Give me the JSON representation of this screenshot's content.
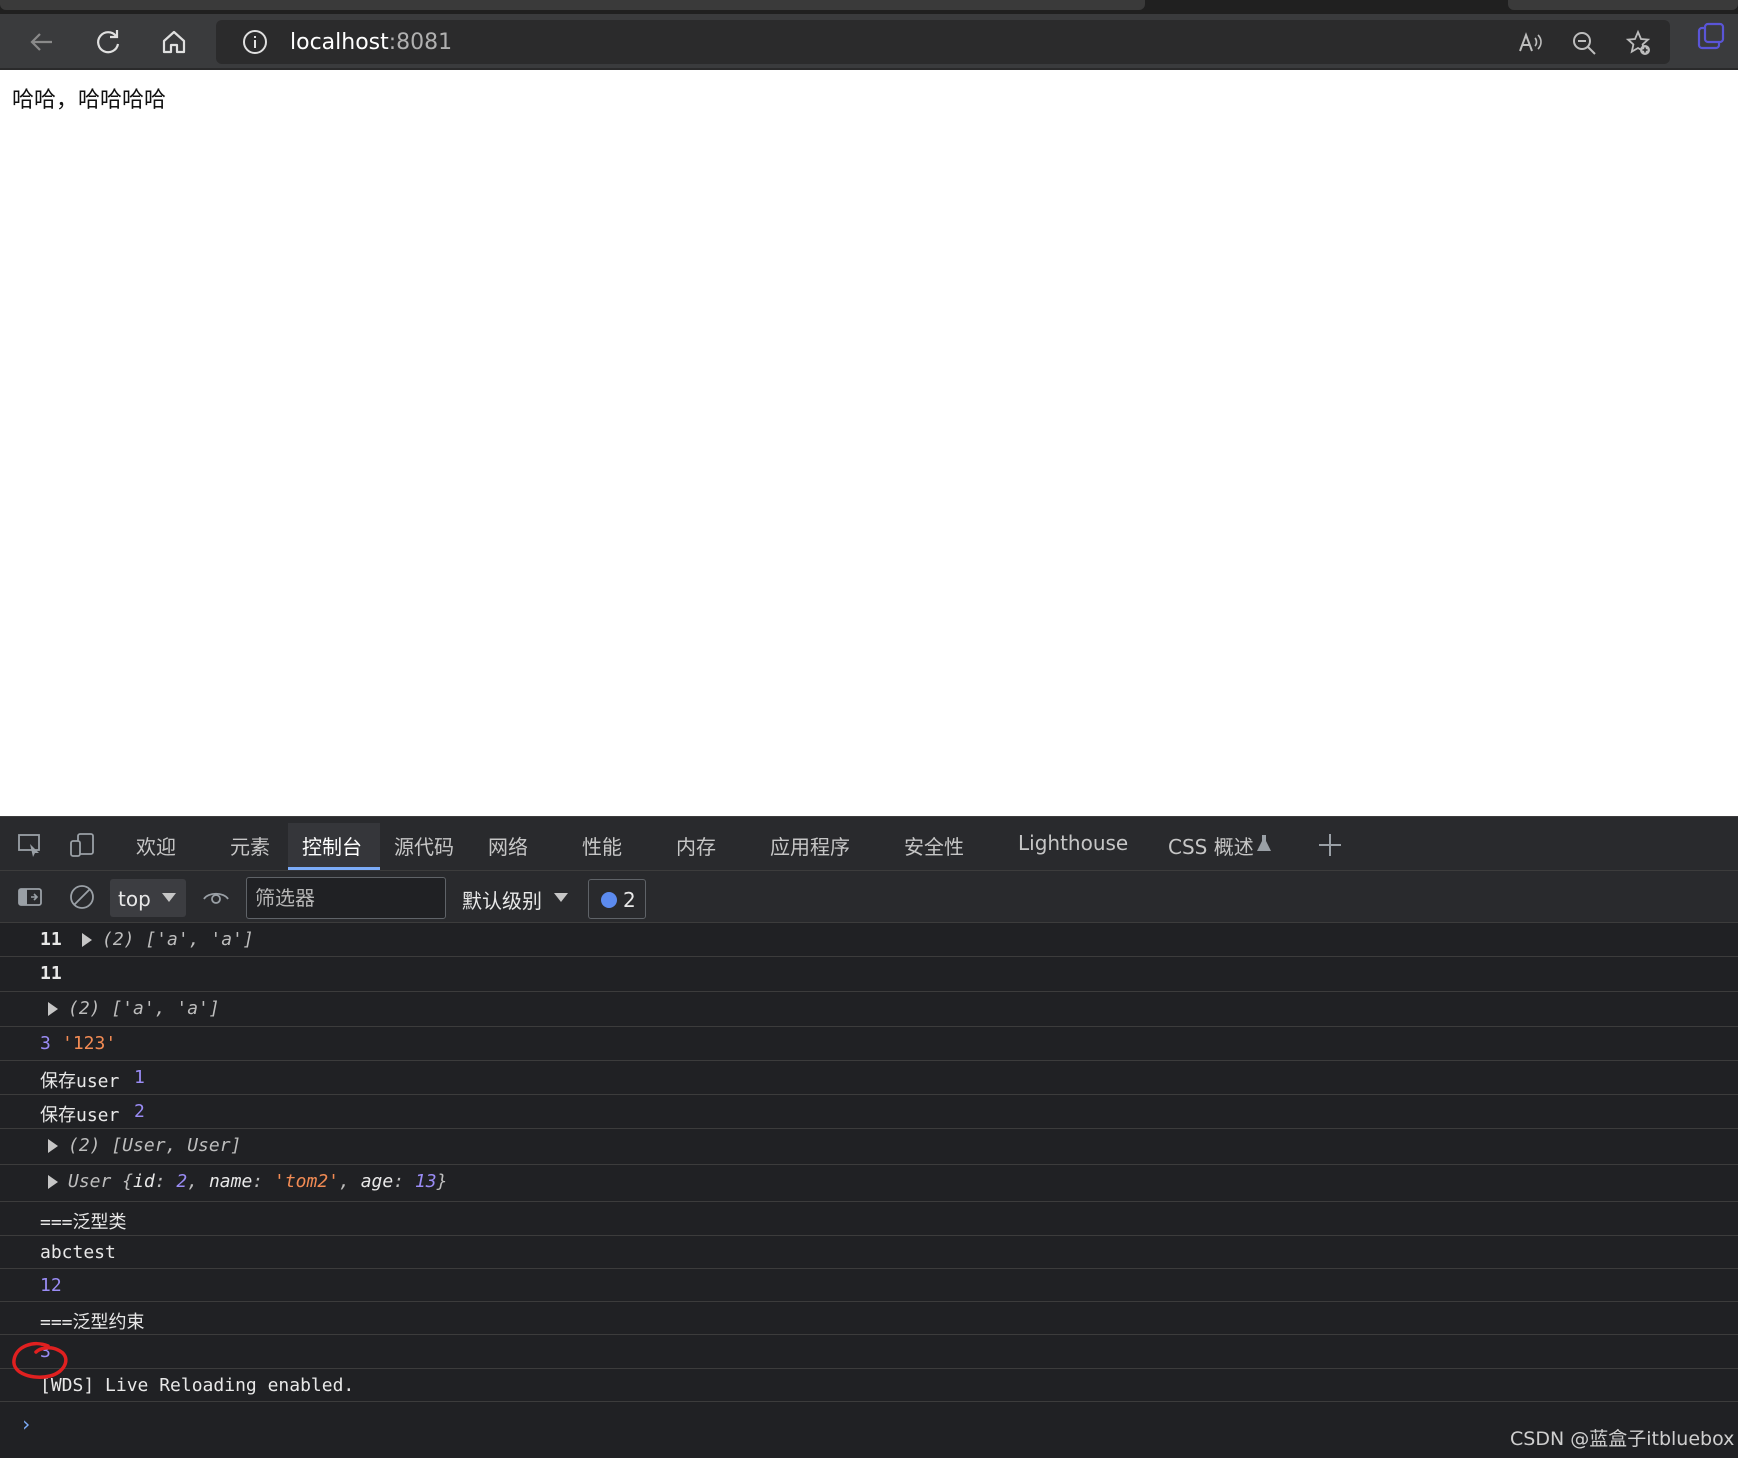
{
  "browser": {
    "url_host": "localhost",
    "url_port": ":8081",
    "icons": [
      "back-icon",
      "refresh-icon",
      "home-icon",
      "info-icon",
      "read-aloud-icon",
      "zoom-out-icon",
      "favorites-add-icon",
      "extension-icon"
    ]
  },
  "page": {
    "text": "哈哈，哈哈哈哈"
  },
  "devtools": {
    "tabs": [
      "欢迎",
      "元素",
      "控制台",
      "源代码",
      "网络",
      "性能",
      "内存",
      "应用程序",
      "安全性",
      "Lighthouse",
      "CSS 概述"
    ],
    "active_tab": "控制台",
    "toolbar": {
      "context": "top",
      "filter_placeholder": "筛选器",
      "level": "默认级别",
      "issues_count": "2"
    },
    "console": {
      "r1_num": "11",
      "r1_arr": "(2) ['a', 'a']",
      "r2_num": "11",
      "r3_arr": "(2) ['a', 'a']",
      "r4_num": "3",
      "r4_str": "'123'",
      "r5_txt": "保存user",
      "r5_num": "1",
      "r6_txt": "保存user",
      "r6_num": "2",
      "r7_arr": "(2) [User, User]",
      "r8_head": "User {",
      "r8_id_key": "id",
      "r8_id_val": "2",
      "r8_name_key": "name",
      "r8_name_val": "'tom2'",
      "r8_age_key": "age",
      "r8_age_val": "13",
      "r9_txt": "===泛型类",
      "r10_txt": "abctest",
      "r11_num": "12",
      "r12_txt": "===泛型约束",
      "r13_num": "3",
      "r14_txt": "[WDS] Live Reloading enabled."
    },
    "prompt": "›"
  },
  "watermark": "CSDN @蓝盒子itbluebox",
  "colors": {
    "number": "#9a8cf5",
    "string": "#f28b54",
    "key": "#7cacf8",
    "annotation": "#e02020"
  }
}
